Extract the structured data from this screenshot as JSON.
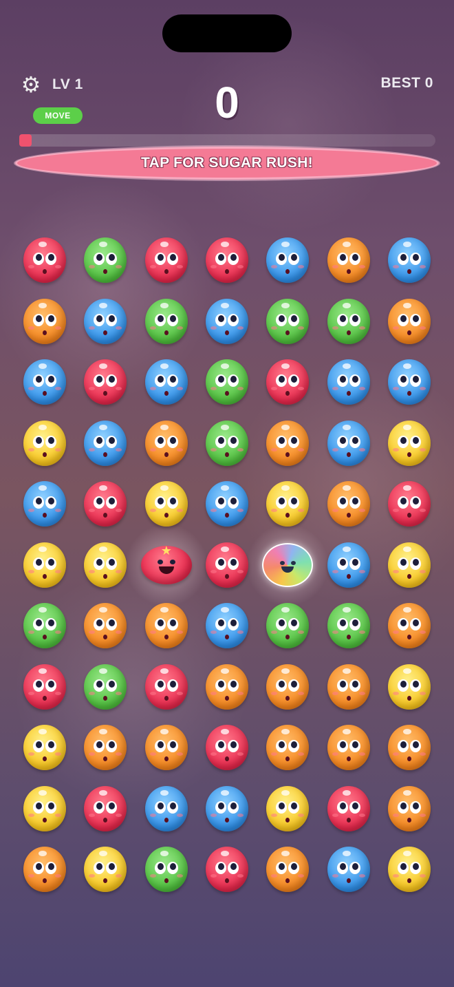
{
  "hud": {
    "level": "LV 1",
    "move_label": "MOVE",
    "score": "0",
    "best": "BEST 0",
    "progress": 0.0
  },
  "rush_button": {
    "label": "TAP FOR SUGAR RUSH!"
  },
  "board": {
    "rows": [
      [
        "red",
        "green",
        "red",
        "red",
        "blue",
        "orange",
        "blue"
      ],
      [
        "orange",
        "blue",
        "green",
        "blue",
        "green",
        "green",
        "orange"
      ],
      [
        "blue",
        "red",
        "blue",
        "green",
        "red",
        "blue",
        "blue"
      ],
      [
        "yellow",
        "blue",
        "orange",
        "green",
        "orange",
        "blue",
        "yellow"
      ],
      [
        "blue",
        "red",
        "yellow",
        "blue",
        "yellow",
        "orange",
        "red"
      ],
      [
        "yellow",
        "yellow",
        "special-red",
        "red",
        "rainbow",
        "blue",
        "yellow"
      ],
      [
        "green",
        "orange",
        "orange",
        "blue",
        "green",
        "green",
        "orange"
      ],
      [
        "red",
        "green",
        "red",
        "orange",
        "orange",
        "orange",
        "yellow"
      ],
      [
        "yellow",
        "orange",
        "orange",
        "red",
        "orange",
        "orange",
        "orange"
      ],
      [
        "yellow",
        "red",
        "blue",
        "blue",
        "yellow",
        "red",
        "orange"
      ],
      [
        "orange",
        "yellow",
        "green",
        "red",
        "orange",
        "blue",
        "yellow"
      ]
    ]
  },
  "icons": {
    "settings": "gear-icon"
  },
  "colors": {
    "red": "#e8284c",
    "green": "#4fbf3d",
    "blue": "#2f8fe8",
    "orange": "#f5851d",
    "yellow": "#f8c51d",
    "move_badge": "#5ccf49",
    "rush_button": "#f47a95"
  }
}
